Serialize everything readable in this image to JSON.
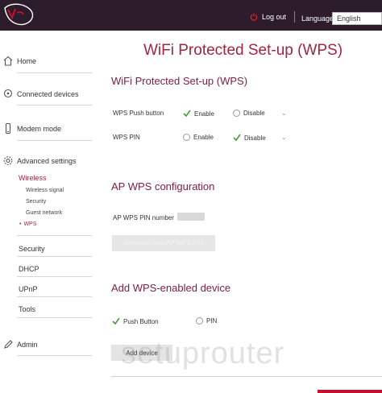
{
  "header": {
    "logout_label": "Log out",
    "language_label": "Language",
    "language_selected": "English",
    "brand_color": "#2d1d2c",
    "accent_color": "#c8102e"
  },
  "sidebar": {
    "home": "Home",
    "connected_devices": "Connected devices",
    "modem_mode": "Modem mode",
    "advanced_settings": "Advanced settings",
    "wireless": "Wireless",
    "wireless_signal": "Wireless signal",
    "wireless_security": "Security",
    "guest_network": "Guest network",
    "wps": "WPS",
    "security": "Security",
    "dhcp": "DHCP",
    "upnp": "UPnP",
    "tools": "Tools",
    "admin": "Admin"
  },
  "main": {
    "page_title": "WiFi Protected Set-up (WPS)",
    "wps_section": {
      "title": "WiFi Protected Set-up (WPS)",
      "push_button_label": "WPS Push button",
      "push_enable": "Enable",
      "push_disable": "Disable",
      "push_selected": "Enable",
      "pin_label": "WPS PIN",
      "pin_enable": "Enable",
      "pin_disable": "Disable",
      "pin_selected": "Disable"
    },
    "ap_section": {
      "title": "AP WPS configuration",
      "pin_number_label": "AP WPS PIN number",
      "generate_button": "Generate new AP WPS PIN"
    },
    "add_section": {
      "title": "Add WPS-enabled device",
      "push_button_option": "Push Button",
      "pin_option": "PIN",
      "selected": "Push Button",
      "add_button": "Add device"
    }
  },
  "watermark": "setuprouter"
}
